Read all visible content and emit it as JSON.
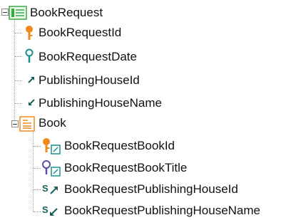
{
  "tree": {
    "root": {
      "label": "BookRequest",
      "icon": "transaction-table-icon",
      "expanded": true,
      "attributes": [
        {
          "label": "BookRequestId",
          "icon": "key-icon"
        },
        {
          "label": "BookRequestDate",
          "icon": "description-key-icon"
        },
        {
          "label": "PublishingHouseId",
          "icon": "foreign-key-icon"
        },
        {
          "label": "PublishingHouseName",
          "icon": "inferred-attribute-icon"
        }
      ],
      "levels": [
        {
          "label": "Book",
          "icon": "level-icon",
          "expanded": true,
          "attributes": [
            {
              "label": "BookRequestBookId",
              "icon": "key-subtype-icon"
            },
            {
              "label": "BookRequestBookTitle",
              "icon": "description-subtype-icon"
            },
            {
              "label": "BookRequestPublishingHouseId",
              "icon": "subtype-foreign-key-icon"
            },
            {
              "label": "BookRequestPublishingHouseName",
              "icon": "subtype-inferred-icon"
            }
          ]
        }
      ]
    }
  },
  "colors": {
    "key": "#f08a1c",
    "description": "#1a8f8f",
    "foreign": "#1a5e5e",
    "subtype_key": "#f08a1c",
    "subtype_desc": "#5a4fa8",
    "table_green": "#3aa845",
    "level_orange": "#f08a1c",
    "connector": "#9a9a9a"
  }
}
